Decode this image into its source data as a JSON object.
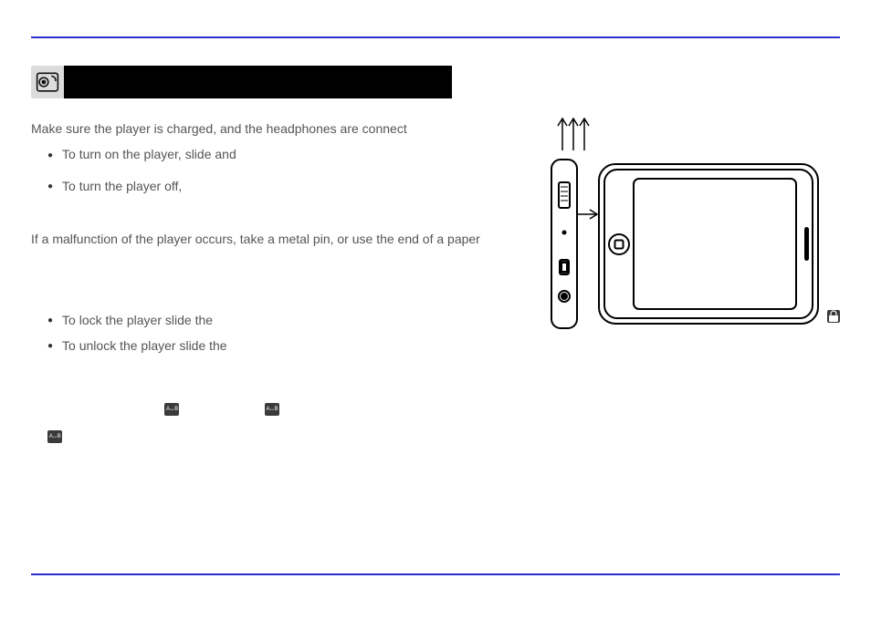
{
  "section": {
    "intro": "Make sure the player is charged, and the headphones are connect",
    "power_on": "To turn on the player, slide and",
    "power_off": "To turn the player off,",
    "malfunction": "If a malfunction of the player occurs, take a metal pin, or use the end of a paper",
    "lock": "To lock the player slide the",
    "unlock": "To unlock the player slide the"
  },
  "icons": {
    "ab_label": "A↔B"
  }
}
